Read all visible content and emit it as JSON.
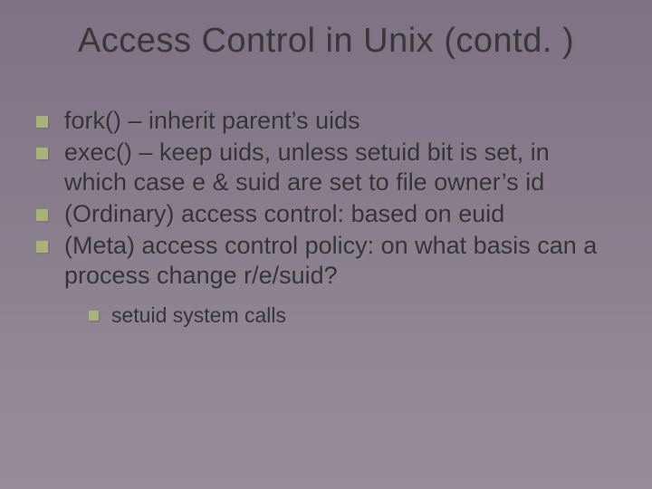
{
  "title": "Access Control in Unix (contd. )",
  "bullets": [
    "fork() – inherit parent’s uids",
    "exec() – keep uids, unless setuid bit is set, in which case e & suid are set to file owner’s id",
    "(Ordinary) access control: based on euid",
    "(Meta) access control policy: on what basis can a process change r/e/suid?"
  ],
  "sub_bullets": [
    "setuid system calls"
  ]
}
